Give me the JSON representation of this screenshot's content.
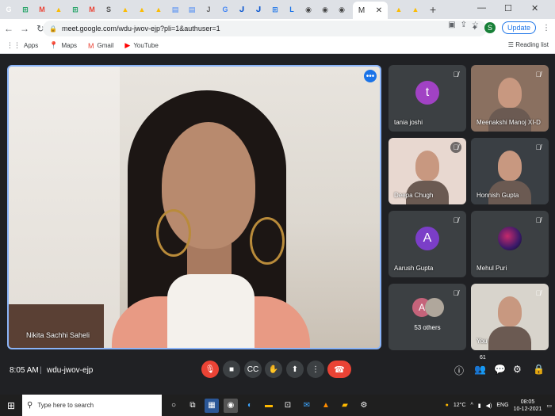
{
  "browser": {
    "tabs": [
      {
        "glyph": "G",
        "color": "#ffffff"
      },
      {
        "glyph": "⊞",
        "color": "#0f9d58"
      },
      {
        "glyph": "M",
        "color": "#ea4335"
      },
      {
        "glyph": "▲",
        "color": "#fbbc04"
      },
      {
        "glyph": "⊞",
        "color": "#0f9d58"
      },
      {
        "glyph": "M",
        "color": "#ea4335"
      },
      {
        "glyph": "S",
        "color": "#555555"
      },
      {
        "glyph": "▲",
        "color": "#fbbc04"
      },
      {
        "glyph": "▲",
        "color": "#fbbc04"
      },
      {
        "glyph": "▲",
        "color": "#fbbc04"
      },
      {
        "glyph": "▤",
        "color": "#4285f4"
      },
      {
        "glyph": "▤",
        "color": "#4285f4"
      },
      {
        "glyph": "J",
        "color": "#666666"
      },
      {
        "glyph": "G",
        "color": "#4285f4"
      },
      {
        "glyph": "ᒍ",
        "color": "#0b57d0"
      },
      {
        "glyph": "ᒍ",
        "color": "#0b57d0"
      },
      {
        "glyph": "⊞",
        "color": "#1a73e8"
      },
      {
        "glyph": "L",
        "color": "#1a73e8"
      },
      {
        "glyph": "◉",
        "color": "#444444"
      },
      {
        "glyph": "◉",
        "color": "#444444"
      },
      {
        "glyph": "◉",
        "color": "#444444"
      },
      {
        "glyph": "▲",
        "color": "#fbbc04"
      },
      {
        "glyph": "▲",
        "color": "#fbbc04"
      }
    ],
    "active_tab": {
      "label": "M",
      "close": "✕"
    },
    "new_tab": "+",
    "window_controls": [
      "—",
      "☐",
      "✕"
    ],
    "url": "meet.google.com/wdu-jwov-ejp?pli=1&authuser=1",
    "profile_initial": "S",
    "update_label": "Update",
    "bookmarks": [
      {
        "icon": "⋮⋮",
        "label": "Apps",
        "color": "#5f6368"
      },
      {
        "icon": "📍",
        "label": "Maps",
        "color": "#34a853"
      },
      {
        "icon": "M",
        "label": "Gmail",
        "color": "#ea4335"
      },
      {
        "icon": "▶",
        "label": "YouTube",
        "color": "#ff0000"
      }
    ],
    "reading_list": "Reading list"
  },
  "meet": {
    "main_speaker": "Nikita Sachhi Saheli",
    "participants": [
      {
        "name": "tania joshi",
        "avatar": "t",
        "avatar_color": "#a142c4",
        "type": "letter"
      },
      {
        "name": "Meenakshi Manoj XI-D",
        "type": "photo",
        "bg": "#8a7060"
      },
      {
        "name": "Deepa Chugh",
        "type": "photo",
        "bg": "#e8d8d0"
      },
      {
        "name": "Honnish Gupta",
        "type": "photo",
        "bg": "#3a3f44"
      },
      {
        "name": "Aarush Gupta",
        "avatar": "A",
        "avatar_color": "#7b3ec8",
        "type": "letter"
      },
      {
        "name": "Mehul Puri",
        "type": "planet"
      },
      {
        "name": "53 others",
        "type": "others"
      },
      {
        "name": "You",
        "type": "photo",
        "bg": "#d8d4cc"
      }
    ],
    "others_avatar": "A",
    "clock": "8:05 AM",
    "meeting_code": "wdu-jwov-ejp",
    "participant_count": "61"
  },
  "taskbar": {
    "search_placeholder": "Type here to search",
    "weather": "12°C",
    "lang": "ENG",
    "time": "08:05",
    "date": "10-12-2021"
  }
}
